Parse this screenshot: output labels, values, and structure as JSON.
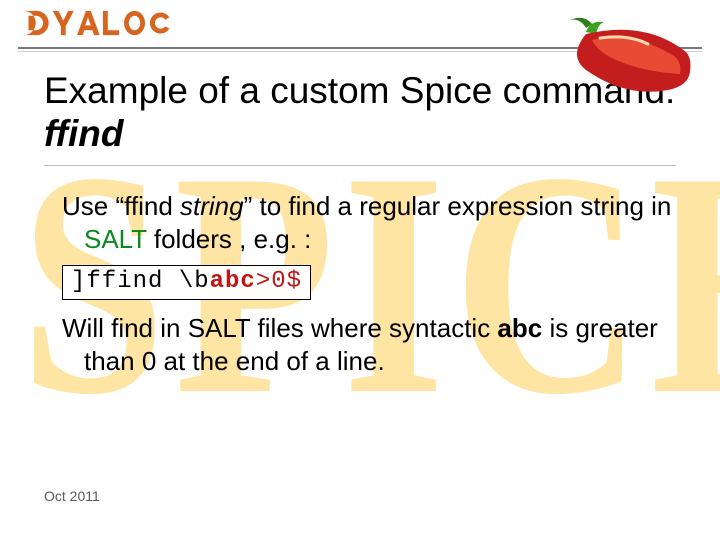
{
  "brand": {
    "name": "DYALOG"
  },
  "decor": {
    "bg_word": "SPICE",
    "chili_alt": "chili-pepper-icon"
  },
  "title": {
    "part1": "Example of a custom Spice command: ",
    "cmd": "ffind"
  },
  "para1": {
    "t1": "Use “ffind ",
    "string_word": "string",
    "t2": "” to find a regular expression string in ",
    "salt": "SALT",
    "t3": " folders , e.g. :"
  },
  "code": {
    "plain1": "]ffind \\b",
    "abc": "abc",
    "tail": ">0$"
  },
  "para2": {
    "t1": "Will find in SALT files where syntactic ",
    "abc": "abc",
    "t2": " is  greater than 0 at the end of a line."
  },
  "footer": {
    "date": "Oct  2011"
  }
}
